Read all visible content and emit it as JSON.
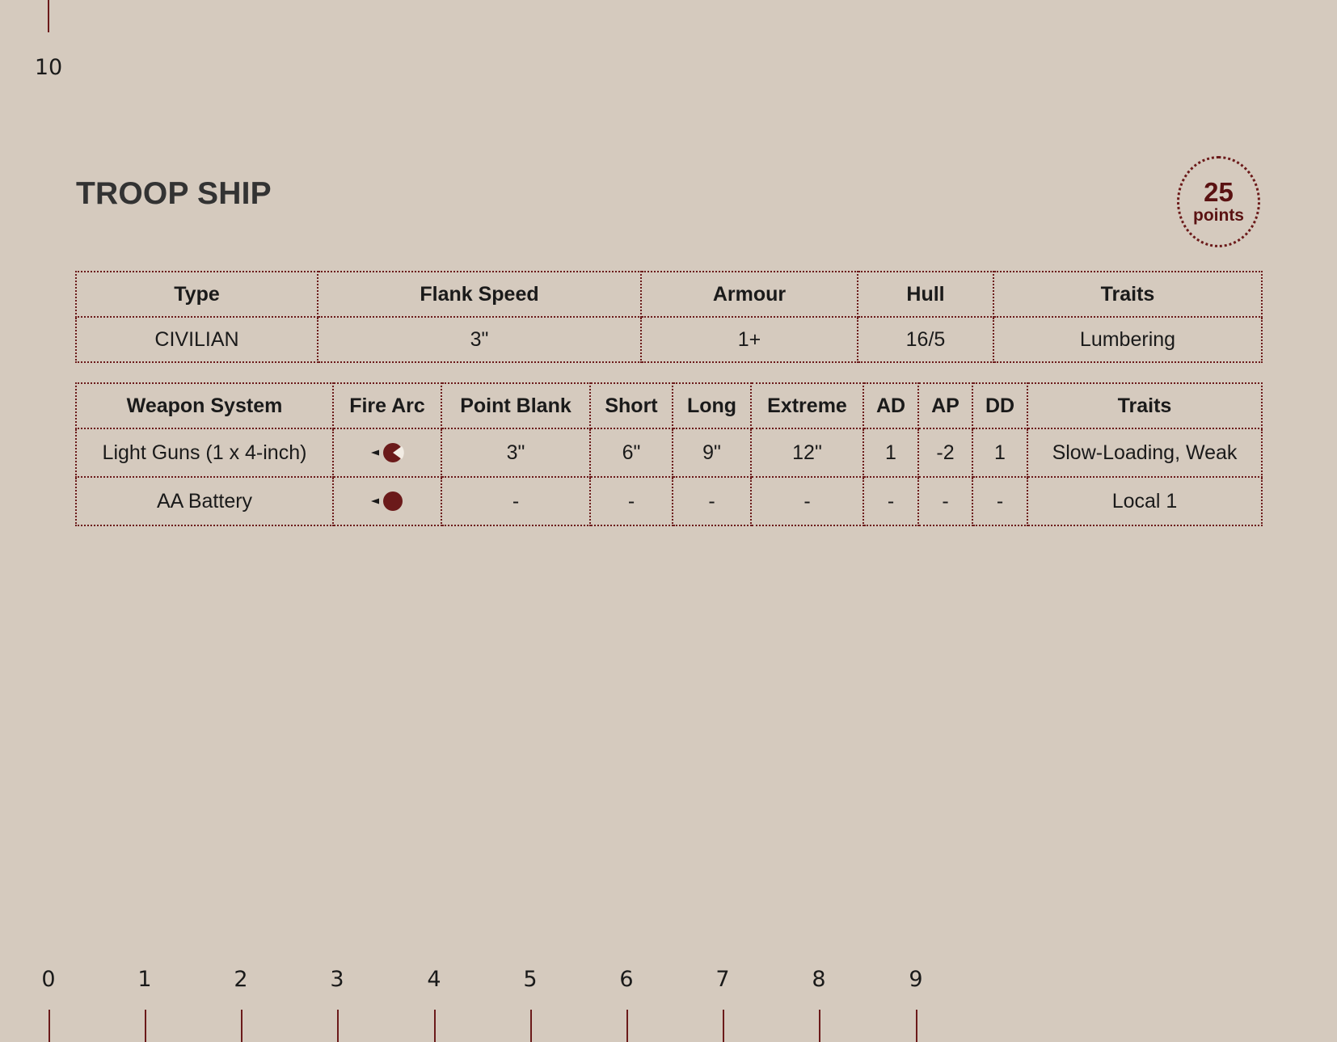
{
  "ruler": {
    "top_label": "10",
    "bottom_labels": [
      "0",
      "1",
      "2",
      "3",
      "4",
      "5",
      "6",
      "7",
      "8",
      "9"
    ]
  },
  "ship": {
    "name": "TROOP SHIP",
    "points_value": "25",
    "points_label": "points"
  },
  "stats_table": {
    "headers": [
      "Type",
      "Flank Speed",
      "Armour",
      "Hull",
      "Traits"
    ],
    "values": [
      "CIVILIAN",
      "3\"",
      "1+",
      "16/5",
      "Lumbering"
    ]
  },
  "weapons_table": {
    "headers": [
      "Weapon System",
      "Fire Arc",
      "Point Blank",
      "Short",
      "Long",
      "Extreme",
      "AD",
      "AP",
      "DD",
      "Traits"
    ],
    "rows": [
      {
        "weapon": "Light Guns (1 x 4-inch)",
        "fire_arc_icon": "partial-arc-icon",
        "point_blank": "3\"",
        "short": "6\"",
        "long": "9\"",
        "extreme": "12\"",
        "ad": "1",
        "ap": "-2",
        "dd": "1",
        "traits": "Slow-Loading, Weak"
      },
      {
        "weapon": "AA Battery",
        "fire_arc_icon": "all-round-arc-icon",
        "point_blank": "-",
        "short": "-",
        "long": "-",
        "extreme": "-",
        "ad": "-",
        "ap": "-",
        "dd": "-",
        "traits": "Local 1"
      }
    ]
  },
  "colors": {
    "background": "#d5cabe",
    "accent": "#6b1a1a",
    "text": "#1a1a1a"
  }
}
